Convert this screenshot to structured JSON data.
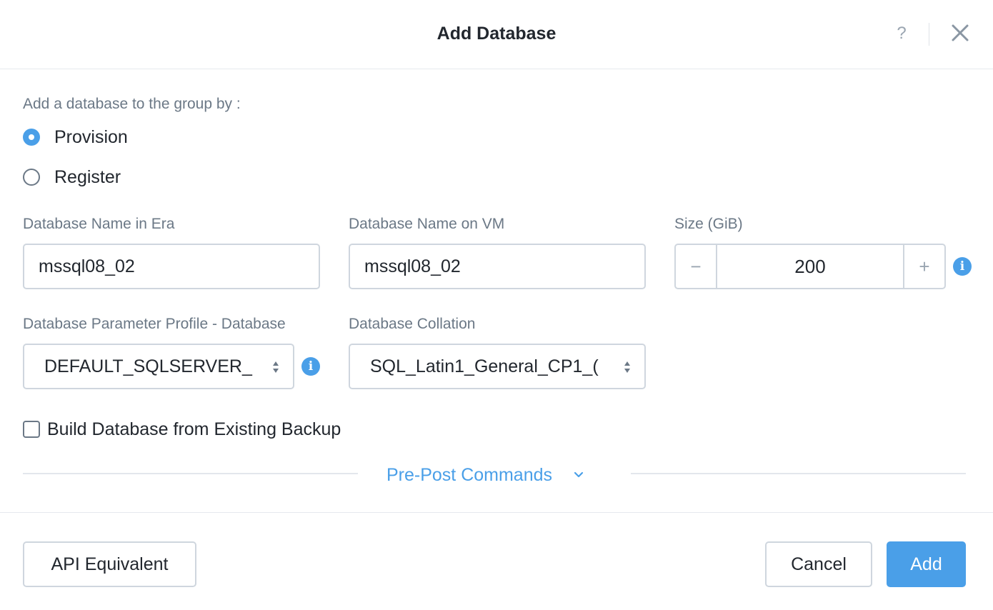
{
  "dialog": {
    "title": "Add Database",
    "help_label": "?",
    "close_label": "close"
  },
  "add_method": {
    "label": "Add a database to the group by :",
    "options": [
      {
        "label": "Provision",
        "selected": true
      },
      {
        "label": "Register",
        "selected": false
      }
    ]
  },
  "fields": {
    "db_name_era": {
      "label": "Database Name in Era",
      "value": "mssql08_02"
    },
    "db_name_vm": {
      "label": "Database Name on VM",
      "value": "mssql08_02"
    },
    "size": {
      "label": "Size (GiB)",
      "value": "200",
      "decrement": "−",
      "increment": "+"
    },
    "param_profile": {
      "label": "Database Parameter Profile - Database",
      "value": "DEFAULT_SQLSERVER_"
    },
    "collation": {
      "label": "Database Collation",
      "value": "SQL_Latin1_General_CP1_("
    }
  },
  "backup_checkbox": {
    "label": "Build Database from Existing Backup",
    "checked": false
  },
  "pre_post": {
    "label": "Pre-Post Commands"
  },
  "footer": {
    "api_label": "API Equivalent",
    "cancel_label": "Cancel",
    "add_label": "Add"
  },
  "colors": {
    "accent": "#4a9fe8",
    "text": "#22272e",
    "muted": "#6b7886",
    "border": "#cfd6de"
  },
  "icons": {
    "help": "question-mark-icon",
    "close": "close-icon",
    "info": "info-icon",
    "caret": "select-caret-icon",
    "chevron": "chevron-down-icon"
  }
}
